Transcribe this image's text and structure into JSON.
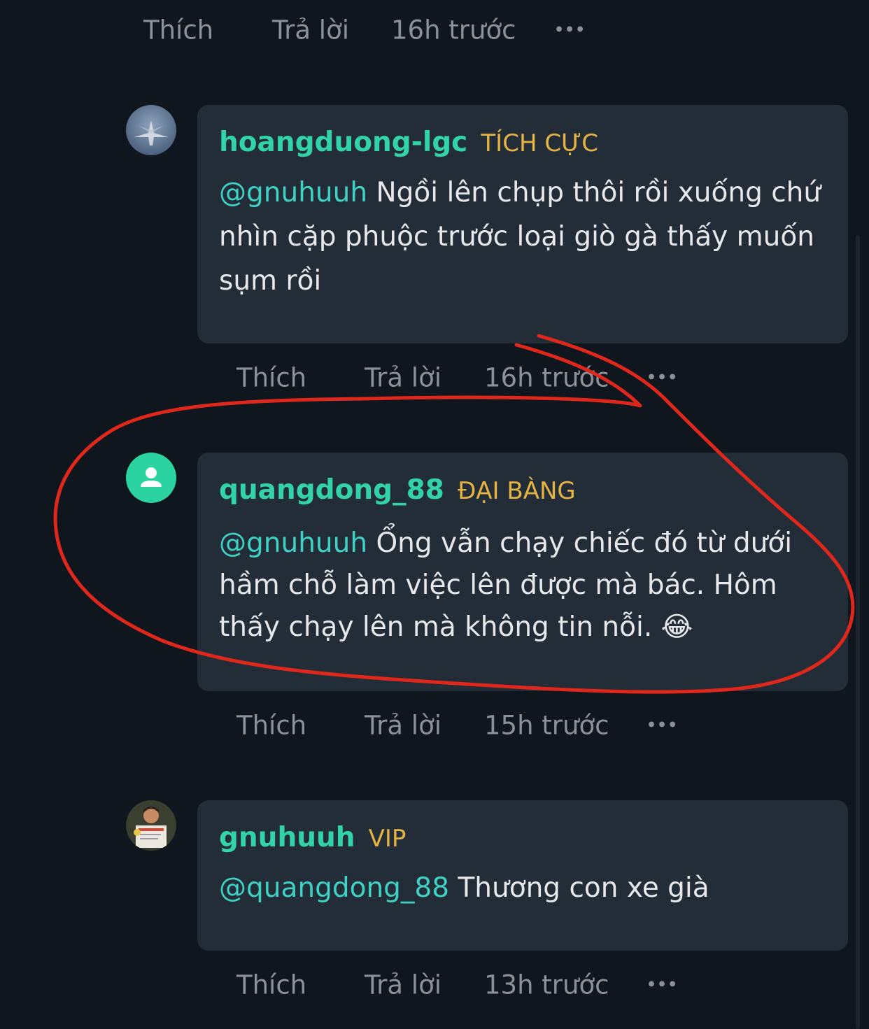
{
  "actions": {
    "like": "Thích",
    "reply": "Trả lời",
    "more": "•••"
  },
  "top_action_row": {
    "time": "16h trước"
  },
  "comments": [
    {
      "username": "hoangduong-lgc",
      "rank": "TÍCH CỰC",
      "mention": "@gnuhuuh",
      "text": " Ngồi lên chụp thôi rồi xuống chứ nhìn cặp phuộc trước loại giò gà thấy muốn sụm rồi",
      "time": "16h trước"
    },
    {
      "username": "quangdong_88",
      "rank": "ĐẠI BÀNG",
      "mention": "@gnuhuuh",
      "text": " Ổng vẫn chạy chiếc đó từ dưới hầm chỗ làm việc lên được mà bác. Hôm thấy chạy lên mà không tin nỗi. 😂",
      "time": "15h trước"
    },
    {
      "username": "gnuhuuh",
      "rank": "VIP",
      "mention": "@quangdong_88",
      "text": " Thương con xe già",
      "time": "13h trước"
    }
  ],
  "colors": {
    "background": "#0f161d",
    "bubble": "#232d37",
    "username": "#33d3a9",
    "rank": "#e5b343",
    "mention": "#3fd1c3",
    "action": "#8a9198",
    "annotation": "#e0271b"
  }
}
